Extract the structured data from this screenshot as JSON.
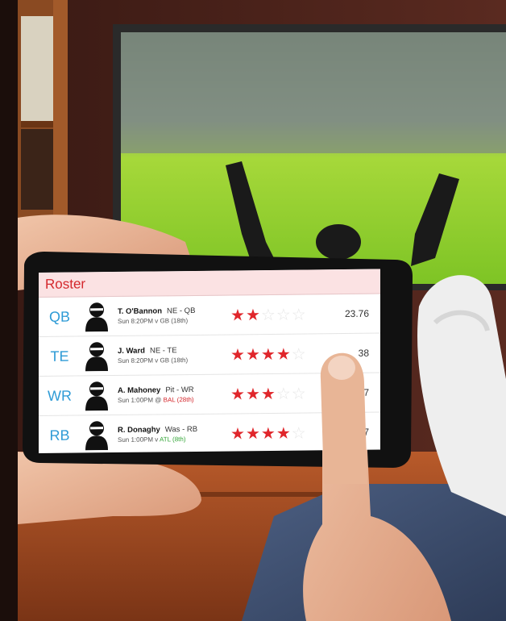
{
  "roster": {
    "title": "Roster",
    "players": [
      {
        "position": "QB",
        "name": "T. O'Bannon",
        "team_pos": "NE - QB",
        "game": "Sun 8:20PM v GB",
        "opponent_rank": "(18th)",
        "rank_tone": "neutral",
        "rating": 2,
        "max_rating": 5,
        "points": "23.76"
      },
      {
        "position": "TE",
        "name": "J. Ward",
        "team_pos": "NE - TE",
        "game": "Sun 8:20PM v GB",
        "opponent_rank": "(18th)",
        "rank_tone": "neutral",
        "rating": 4,
        "max_rating": 5,
        "points": "38"
      },
      {
        "position": "WR",
        "name": "A. Mahoney",
        "team_pos": "Pit - WR",
        "game": "Sun 1:00PM @",
        "opponent_rank": "BAL (28th)",
        "rank_tone": "hard",
        "rating": 3,
        "max_rating": 5,
        "points": "7"
      },
      {
        "position": "RB",
        "name": "R. Donaghy",
        "team_pos": "Was - RB",
        "game": "Sun 1:00PM v",
        "opponent_rank": "ATL (8th)",
        "rank_tone": "easy",
        "rating": 4,
        "max_rating": 5,
        "points": "7"
      }
    ]
  },
  "colors": {
    "accent_red": "#d4272c",
    "position_blue": "#2e9bd6",
    "header_bg": "#fbe2e3",
    "field_green": "#8fd32f"
  },
  "icons": {
    "player_avatar": "helmet-player-icon",
    "star": "star-icon"
  }
}
